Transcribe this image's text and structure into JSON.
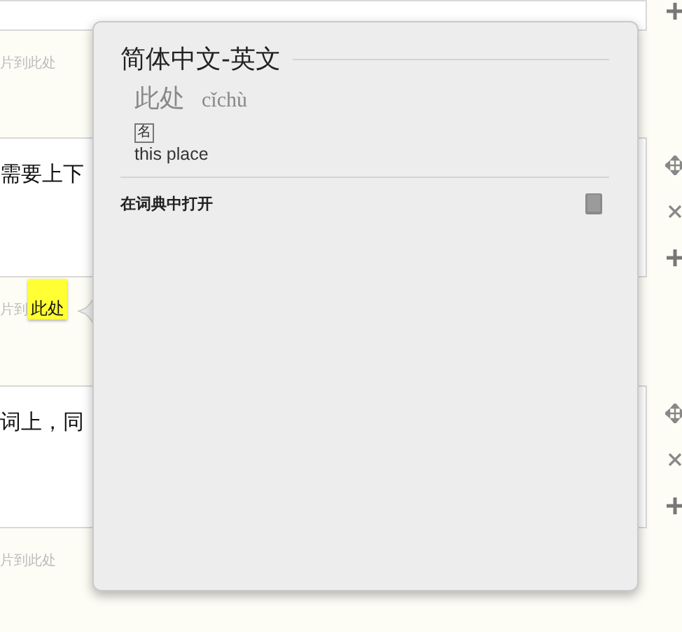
{
  "editor": {
    "blocks": [
      {
        "kind": "text_box"
      },
      {
        "kind": "drop_zone",
        "text": "片到此处"
      },
      {
        "kind": "text_box",
        "text": "需要上下"
      },
      {
        "kind": "drop_zone",
        "text": "片到",
        "highlight": "此处"
      },
      {
        "kind": "text_box",
        "text": "词上，同"
      },
      {
        "kind": "drop_zone",
        "text": "片到此处"
      }
    ]
  },
  "side_tools": [
    {
      "tools": [
        {
          "kind": "add"
        }
      ]
    },
    {
      "tools": [
        {
          "kind": "move"
        },
        {
          "kind": "remove"
        },
        {
          "kind": "add"
        }
      ]
    },
    {
      "tools": [
        {
          "kind": "move"
        },
        {
          "kind": "remove"
        },
        {
          "kind": "add"
        }
      ]
    }
  ],
  "popup": {
    "title": "简体中文-英文",
    "headword": "此处",
    "pinyin": "cǐchù",
    "part_of_speech": "名",
    "definition": "this place",
    "open_in_dictionary": "在词典中打开"
  }
}
